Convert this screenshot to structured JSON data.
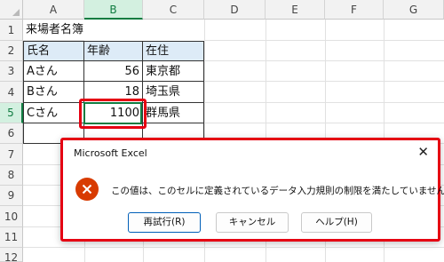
{
  "columns": [
    "A",
    "B",
    "C",
    "D",
    "E",
    "F",
    "G"
  ],
  "rows": [
    "1",
    "2",
    "3",
    "4",
    "5",
    "6",
    "7",
    "8",
    "9",
    "10",
    "11",
    "12"
  ],
  "cells": {
    "a1": "来場者名簿",
    "a2": "氏名",
    "b2": "年齢",
    "c2": "在住",
    "a3": "Aさん",
    "b3": "56",
    "c3": "東京都",
    "a4": "Bさん",
    "b4": "18",
    "c4": "埼玉県",
    "a5": "Cさん",
    "b5": "1100",
    "c5": "群馬県"
  },
  "selection": {
    "column": "B",
    "row": "5"
  },
  "dialog": {
    "title": "Microsoft Excel",
    "close_icon": "close-icon",
    "icon": "error-icon",
    "message": "この値は、このセルに定義されているデータ入力規則の制限を満たしていません。",
    "buttons": {
      "retry": "再試行(R)",
      "cancel": "キャンセル",
      "help": "ヘルプ(H)"
    }
  },
  "colors": {
    "accent_green": "#107c41",
    "highlight_red": "#e50012",
    "header_fill": "#ddebf7",
    "error_orange": "#d83b01"
  }
}
